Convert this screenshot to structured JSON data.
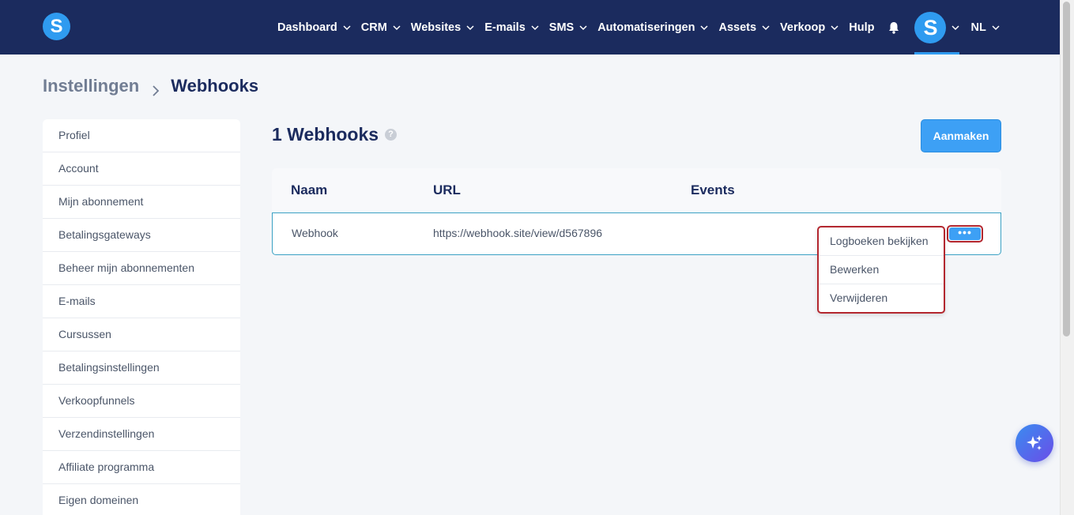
{
  "brand": {
    "logo_letter": "S"
  },
  "nav": {
    "items": [
      {
        "label": "Dashboard",
        "has_dropdown": true
      },
      {
        "label": "CRM",
        "has_dropdown": true
      },
      {
        "label": "Websites",
        "has_dropdown": true
      },
      {
        "label": "E-mails",
        "has_dropdown": true
      },
      {
        "label": "SMS",
        "has_dropdown": true
      },
      {
        "label": "Automatiseringen",
        "has_dropdown": true
      },
      {
        "label": "Assets",
        "has_dropdown": true
      },
      {
        "label": "Verkoop",
        "has_dropdown": true
      },
      {
        "label": "Hulp",
        "has_dropdown": false
      }
    ],
    "notification_icon": "bell-icon",
    "avatar_letter": "S",
    "language": "NL"
  },
  "breadcrumb": {
    "parent": "Instellingen",
    "current": "Webhooks"
  },
  "sidebar": {
    "items": [
      "Profiel",
      "Account",
      "Mijn abonnement",
      "Betalingsgateways",
      "Beheer mijn abonnementen",
      "E-mails",
      "Cursussen",
      "Betalingsinstellingen",
      "Verkoopfunnels",
      "Verzendinstellingen",
      "Affiliate programma",
      "Eigen domeinen"
    ]
  },
  "main": {
    "title": "1 Webhooks",
    "help_icon": "question-icon",
    "create_label": "Aanmaken",
    "table": {
      "columns": [
        "Naam",
        "URL",
        "Events"
      ],
      "rows": [
        {
          "name": "Webhook",
          "url": "https://webhook.site/view/d567896",
          "events": ""
        }
      ]
    },
    "more_label": "•••",
    "menu": {
      "items": [
        "Logboeken bekijken",
        "Bewerken",
        "Verwijderen"
      ]
    }
  },
  "colors": {
    "nav_bg": "#1b2b5e",
    "accent": "#3da0f5",
    "highlight": "#b3272f"
  }
}
